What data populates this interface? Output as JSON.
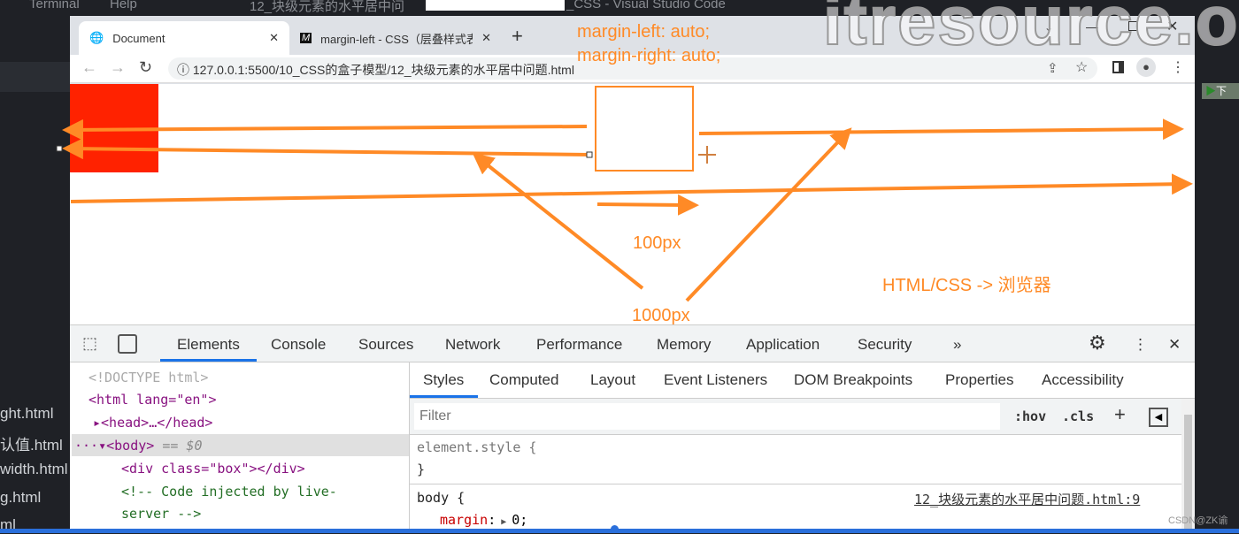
{
  "vscode": {
    "menu": [
      "Terminal",
      "Help"
    ],
    "title_left": "12_块级元素的水平居中问",
    "title_right": "_CSS - Visual Studio Code",
    "files": [
      "ght.html",
      "认值.html",
      "width.html",
      "g.html",
      "ml"
    ],
    "run_label": "下"
  },
  "watermark": "itresource.o",
  "browser": {
    "tabs": [
      {
        "label": "Document",
        "icon": "globe-icon"
      },
      {
        "label": "margin-left - CSS（层叠样式表",
        "icon": "mdn-icon"
      }
    ],
    "url": "127.0.0.1:5500/10_CSS的盒子模型/12_块级元素的水平居中问题.html"
  },
  "annotations": {
    "line1": "margin-left: auto;",
    "line2": "margin-right: auto;",
    "small": "100px",
    "large": "1000px",
    "flow": "HTML/CSS -> 浏览器"
  },
  "colors": {
    "annotation": "#ff8a26",
    "red_box": "#ff2200"
  },
  "devtools": {
    "tabs": [
      "Elements",
      "Console",
      "Sources",
      "Network",
      "Performance",
      "Memory",
      "Application",
      "Security"
    ],
    "active_tab": "Elements",
    "dom": {
      "doctype": "<!DOCTYPE html>",
      "html_open": "<html lang=\"en\">",
      "head": "<head>…</head>",
      "body": "<body>",
      "body_sel": "== $0",
      "div": "<div class=\"box\"></div>",
      "comment1": "<!-- Code injected by live-",
      "comment2": "server -->"
    },
    "subtabs": [
      "Styles",
      "Computed",
      "Layout",
      "Event Listeners",
      "DOM Breakpoints",
      "Properties",
      "Accessibility"
    ],
    "filter_placeholder": "Filter",
    "hov": ":hov",
    "cls": ".cls",
    "rules": {
      "element_style": "element.style {",
      "close": "}",
      "body": "body {",
      "source": "12_块级元素的水平居中问题.html:9",
      "prop": "margin",
      "value": "0;"
    }
  },
  "credit": "CSDN@ZK谕"
}
